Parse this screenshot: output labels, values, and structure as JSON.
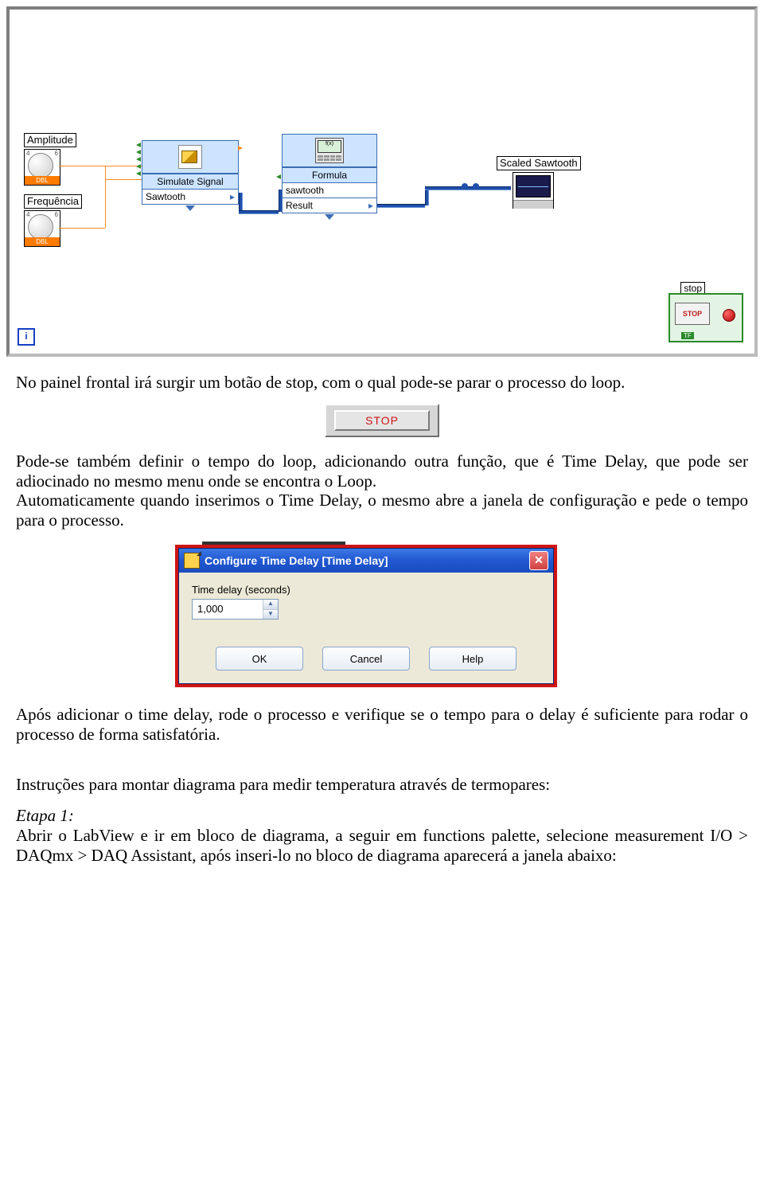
{
  "diagram": {
    "amplitude_label": "Amplitude",
    "frequencia_label": "Frequência",
    "simulate": {
      "title": "Simulate Signal",
      "output": "Sawtooth"
    },
    "formula": {
      "title": "Formula",
      "input": "sawtooth",
      "output": "Result"
    },
    "graph_label": "Scaled Sawtooth",
    "knob_type": "DBL",
    "knob_tick_lo": "4",
    "knob_tick_hi": "6",
    "i_counter": "i",
    "stop_label": "stop",
    "stop_btn": "STOP",
    "tf_tag": "TF"
  },
  "text": {
    "p1": "No painel frontal irá surgir um botão de stop, com o qual pode-se parar o processo do loop.",
    "stop_btn": "STOP",
    "p2a": "Pode-se também definir o tempo do loop, adicionando outra função, que é Time Delay, que pode ser adiocinado no mesmo menu onde se encontra o Loop.",
    "p2b": "Automaticamente quando inserimos o Time Delay, o mesmo abre a janela de configuração e pede o tempo para o processo.",
    "p3": "Após adicionar o time delay, rode o processo e verifique se o tempo para o delay é suficiente para rodar o processo de forma satisfatória.",
    "p4": "Instruções para montar diagrama para medir temperatura através de termopares:",
    "etapa": "Etapa 1:",
    "p5": "Abrir o LabView e ir em bloco de diagrama, a seguir em functions palette, selecione measurement I/O > DAQmx > DAQ Assistant, após inseri-lo no bloco de diagrama aparecerá a janela abaixo:"
  },
  "dialog": {
    "title": "Configure Time Delay [Time Delay]",
    "field_label": "Time delay (seconds)",
    "value": "1,000",
    "ok": "OK",
    "cancel": "Cancel",
    "help": "Help"
  }
}
